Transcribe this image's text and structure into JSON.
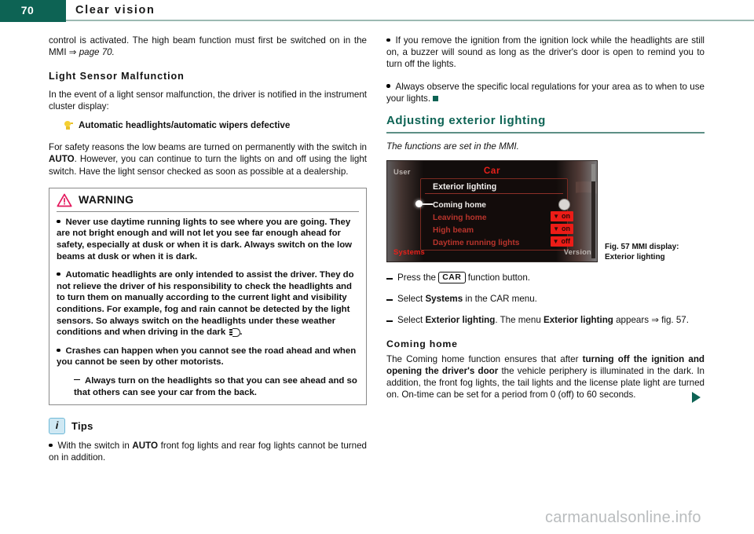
{
  "header": {
    "page_number": "70",
    "chapter_title": "Clear vision",
    "accent_color": "#0d6354"
  },
  "left_column": {
    "intro_paragraph_part1": "control is activated. The high beam function must first be switched on in the MMI ",
    "intro_arrow": "⇒ ",
    "intro_reference": "page 70.",
    "section_heading": "Light Sensor Malfunction",
    "malfunction_paragraph": "In the event of a light sensor malfunction, the driver is notified in the instrument cluster display:",
    "cluster_message": "Automatic headlights/automatic wipers defective",
    "safety_paragraph_part1": "For safety reasons the low beams are turned on permanently with the switch in ",
    "safety_auto": "AUTO",
    "safety_paragraph_part2": ". However, you can continue to turn the lights on and off using the light switch. Have the light sensor checked as soon as possible at a dealership.",
    "warning": {
      "title": "WARNING",
      "bullets": [
        "Never use daytime running lights to see where you are going. They are not bright enough and will not let you see far enough ahead for safety, especially at dusk or when it is dark. Always switch on the low beams at dusk or when it is dark.",
        "Automatic headlights are only intended to assist the driver. They do not relieve the driver of his responsibility to check the headlights and to turn them on manually according to the current light and visibility conditions. For example, fog and rain cannot be detected by the light sensors. So always switch on the headlights under these weather conditions and when driving in the dark ",
        "Crashes can happen when you cannot see the road ahead and when you cannot be seen by other motorists."
      ],
      "bullet2_suffix": ".",
      "sub_dash": "Always turn on the headlights so that you can see ahead and so that others can see your car from the back."
    },
    "tips": {
      "title": "Tips",
      "icon_char": "i",
      "bullet_part1": "With the switch in ",
      "bullet_auto": "AUTO",
      "bullet_part2": " front fog lights and rear fog lights cannot be turned on in addition."
    }
  },
  "right_column": {
    "bullets": [
      "If you remove the ignition from the ignition lock while the headlights are still on, a buzzer will sound as long as the driver's door is open to remind you to turn off the lights.",
      "Always observe the specific local regulations for your area as to when to use your lights."
    ],
    "section_title": "Adjusting exterior lighting",
    "section_subtitle": "The functions are set in the MMI.",
    "figure": {
      "caption_line1": "Fig. 57   MMI display:",
      "caption_line2": "Exterior lighting",
      "mmi": {
        "left_label": "User",
        "center_label": "Car",
        "bottom_left_label": "Systems",
        "bottom_right_label": "Version",
        "clock_time": "12:00",
        "clock_meridiem": "AM",
        "menu_title": "Exterior lighting",
        "rows": [
          {
            "label": "Coming home",
            "value": "",
            "selected": true
          },
          {
            "label": "Leaving home",
            "value": "on",
            "selected": false
          },
          {
            "label": "High beam",
            "value": "on",
            "selected": false
          },
          {
            "label": "Daytime running lights",
            "value": "off",
            "selected": false
          }
        ],
        "colors": {
          "background": "#100c0b",
          "accent_red": "#e8201a",
          "pill_red": "#ec1c17",
          "text_light": "#efecea"
        }
      }
    },
    "steps": [
      {
        "prefix": "Press the ",
        "keycap": "CAR",
        "suffix": " function button."
      },
      {
        "prefix": "Select ",
        "bold": "Systems",
        "suffix": " in the CAR menu."
      },
      {
        "prefix": "Select ",
        "bold": "Exterior lighting",
        "mid": ". The menu ",
        "bold2": "Exterior lighting",
        "suffix": " appears ⇒ fig. 57."
      }
    ],
    "coming_home": {
      "heading": "Coming home",
      "part1": "The Coming home function ensures that after ",
      "bold": "turning off the ignition and opening the driver's door",
      "part2": " the vehicle periphery is illuminated in the dark. In addition, the front fog lights, the tail lights and the license plate light are turned on. On-time can be set for a period from 0 (off) to 60 seconds."
    }
  },
  "watermark": "carmanualsonline.info"
}
